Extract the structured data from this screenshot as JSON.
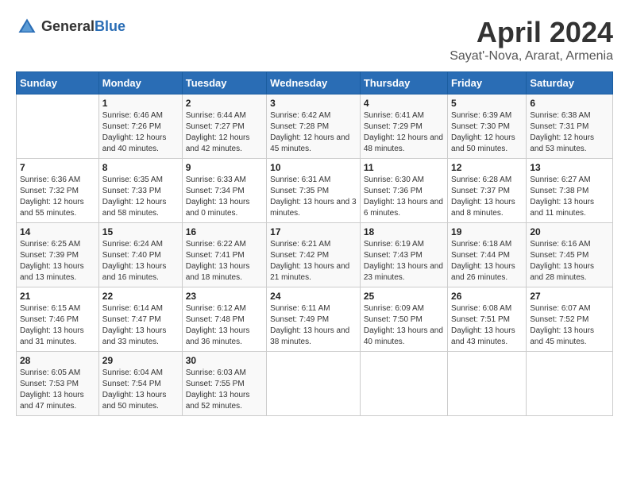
{
  "header": {
    "logo_general": "General",
    "logo_blue": "Blue",
    "title": "April 2024",
    "subtitle": "Sayat'-Nova, Ararat, Armenia"
  },
  "weekdays": [
    "Sunday",
    "Monday",
    "Tuesday",
    "Wednesday",
    "Thursday",
    "Friday",
    "Saturday"
  ],
  "weeks": [
    [
      {
        "day": "",
        "sunrise": "",
        "sunset": "",
        "daylight": ""
      },
      {
        "day": "1",
        "sunrise": "Sunrise: 6:46 AM",
        "sunset": "Sunset: 7:26 PM",
        "daylight": "Daylight: 12 hours and 40 minutes."
      },
      {
        "day": "2",
        "sunrise": "Sunrise: 6:44 AM",
        "sunset": "Sunset: 7:27 PM",
        "daylight": "Daylight: 12 hours and 42 minutes."
      },
      {
        "day": "3",
        "sunrise": "Sunrise: 6:42 AM",
        "sunset": "Sunset: 7:28 PM",
        "daylight": "Daylight: 12 hours and 45 minutes."
      },
      {
        "day": "4",
        "sunrise": "Sunrise: 6:41 AM",
        "sunset": "Sunset: 7:29 PM",
        "daylight": "Daylight: 12 hours and 48 minutes."
      },
      {
        "day": "5",
        "sunrise": "Sunrise: 6:39 AM",
        "sunset": "Sunset: 7:30 PM",
        "daylight": "Daylight: 12 hours and 50 minutes."
      },
      {
        "day": "6",
        "sunrise": "Sunrise: 6:38 AM",
        "sunset": "Sunset: 7:31 PM",
        "daylight": "Daylight: 12 hours and 53 minutes."
      }
    ],
    [
      {
        "day": "7",
        "sunrise": "Sunrise: 6:36 AM",
        "sunset": "Sunset: 7:32 PM",
        "daylight": "Daylight: 12 hours and 55 minutes."
      },
      {
        "day": "8",
        "sunrise": "Sunrise: 6:35 AM",
        "sunset": "Sunset: 7:33 PM",
        "daylight": "Daylight: 12 hours and 58 minutes."
      },
      {
        "day": "9",
        "sunrise": "Sunrise: 6:33 AM",
        "sunset": "Sunset: 7:34 PM",
        "daylight": "Daylight: 13 hours and 0 minutes."
      },
      {
        "day": "10",
        "sunrise": "Sunrise: 6:31 AM",
        "sunset": "Sunset: 7:35 PM",
        "daylight": "Daylight: 13 hours and 3 minutes."
      },
      {
        "day": "11",
        "sunrise": "Sunrise: 6:30 AM",
        "sunset": "Sunset: 7:36 PM",
        "daylight": "Daylight: 13 hours and 6 minutes."
      },
      {
        "day": "12",
        "sunrise": "Sunrise: 6:28 AM",
        "sunset": "Sunset: 7:37 PM",
        "daylight": "Daylight: 13 hours and 8 minutes."
      },
      {
        "day": "13",
        "sunrise": "Sunrise: 6:27 AM",
        "sunset": "Sunset: 7:38 PM",
        "daylight": "Daylight: 13 hours and 11 minutes."
      }
    ],
    [
      {
        "day": "14",
        "sunrise": "Sunrise: 6:25 AM",
        "sunset": "Sunset: 7:39 PM",
        "daylight": "Daylight: 13 hours and 13 minutes."
      },
      {
        "day": "15",
        "sunrise": "Sunrise: 6:24 AM",
        "sunset": "Sunset: 7:40 PM",
        "daylight": "Daylight: 13 hours and 16 minutes."
      },
      {
        "day": "16",
        "sunrise": "Sunrise: 6:22 AM",
        "sunset": "Sunset: 7:41 PM",
        "daylight": "Daylight: 13 hours and 18 minutes."
      },
      {
        "day": "17",
        "sunrise": "Sunrise: 6:21 AM",
        "sunset": "Sunset: 7:42 PM",
        "daylight": "Daylight: 13 hours and 21 minutes."
      },
      {
        "day": "18",
        "sunrise": "Sunrise: 6:19 AM",
        "sunset": "Sunset: 7:43 PM",
        "daylight": "Daylight: 13 hours and 23 minutes."
      },
      {
        "day": "19",
        "sunrise": "Sunrise: 6:18 AM",
        "sunset": "Sunset: 7:44 PM",
        "daylight": "Daylight: 13 hours and 26 minutes."
      },
      {
        "day": "20",
        "sunrise": "Sunrise: 6:16 AM",
        "sunset": "Sunset: 7:45 PM",
        "daylight": "Daylight: 13 hours and 28 minutes."
      }
    ],
    [
      {
        "day": "21",
        "sunrise": "Sunrise: 6:15 AM",
        "sunset": "Sunset: 7:46 PM",
        "daylight": "Daylight: 13 hours and 31 minutes."
      },
      {
        "day": "22",
        "sunrise": "Sunrise: 6:14 AM",
        "sunset": "Sunset: 7:47 PM",
        "daylight": "Daylight: 13 hours and 33 minutes."
      },
      {
        "day": "23",
        "sunrise": "Sunrise: 6:12 AM",
        "sunset": "Sunset: 7:48 PM",
        "daylight": "Daylight: 13 hours and 36 minutes."
      },
      {
        "day": "24",
        "sunrise": "Sunrise: 6:11 AM",
        "sunset": "Sunset: 7:49 PM",
        "daylight": "Daylight: 13 hours and 38 minutes."
      },
      {
        "day": "25",
        "sunrise": "Sunrise: 6:09 AM",
        "sunset": "Sunset: 7:50 PM",
        "daylight": "Daylight: 13 hours and 40 minutes."
      },
      {
        "day": "26",
        "sunrise": "Sunrise: 6:08 AM",
        "sunset": "Sunset: 7:51 PM",
        "daylight": "Daylight: 13 hours and 43 minutes."
      },
      {
        "day": "27",
        "sunrise": "Sunrise: 6:07 AM",
        "sunset": "Sunset: 7:52 PM",
        "daylight": "Daylight: 13 hours and 45 minutes."
      }
    ],
    [
      {
        "day": "28",
        "sunrise": "Sunrise: 6:05 AM",
        "sunset": "Sunset: 7:53 PM",
        "daylight": "Daylight: 13 hours and 47 minutes."
      },
      {
        "day": "29",
        "sunrise": "Sunrise: 6:04 AM",
        "sunset": "Sunset: 7:54 PM",
        "daylight": "Daylight: 13 hours and 50 minutes."
      },
      {
        "day": "30",
        "sunrise": "Sunrise: 6:03 AM",
        "sunset": "Sunset: 7:55 PM",
        "daylight": "Daylight: 13 hours and 52 minutes."
      },
      {
        "day": "",
        "sunrise": "",
        "sunset": "",
        "daylight": ""
      },
      {
        "day": "",
        "sunrise": "",
        "sunset": "",
        "daylight": ""
      },
      {
        "day": "",
        "sunrise": "",
        "sunset": "",
        "daylight": ""
      },
      {
        "day": "",
        "sunrise": "",
        "sunset": "",
        "daylight": ""
      }
    ]
  ]
}
